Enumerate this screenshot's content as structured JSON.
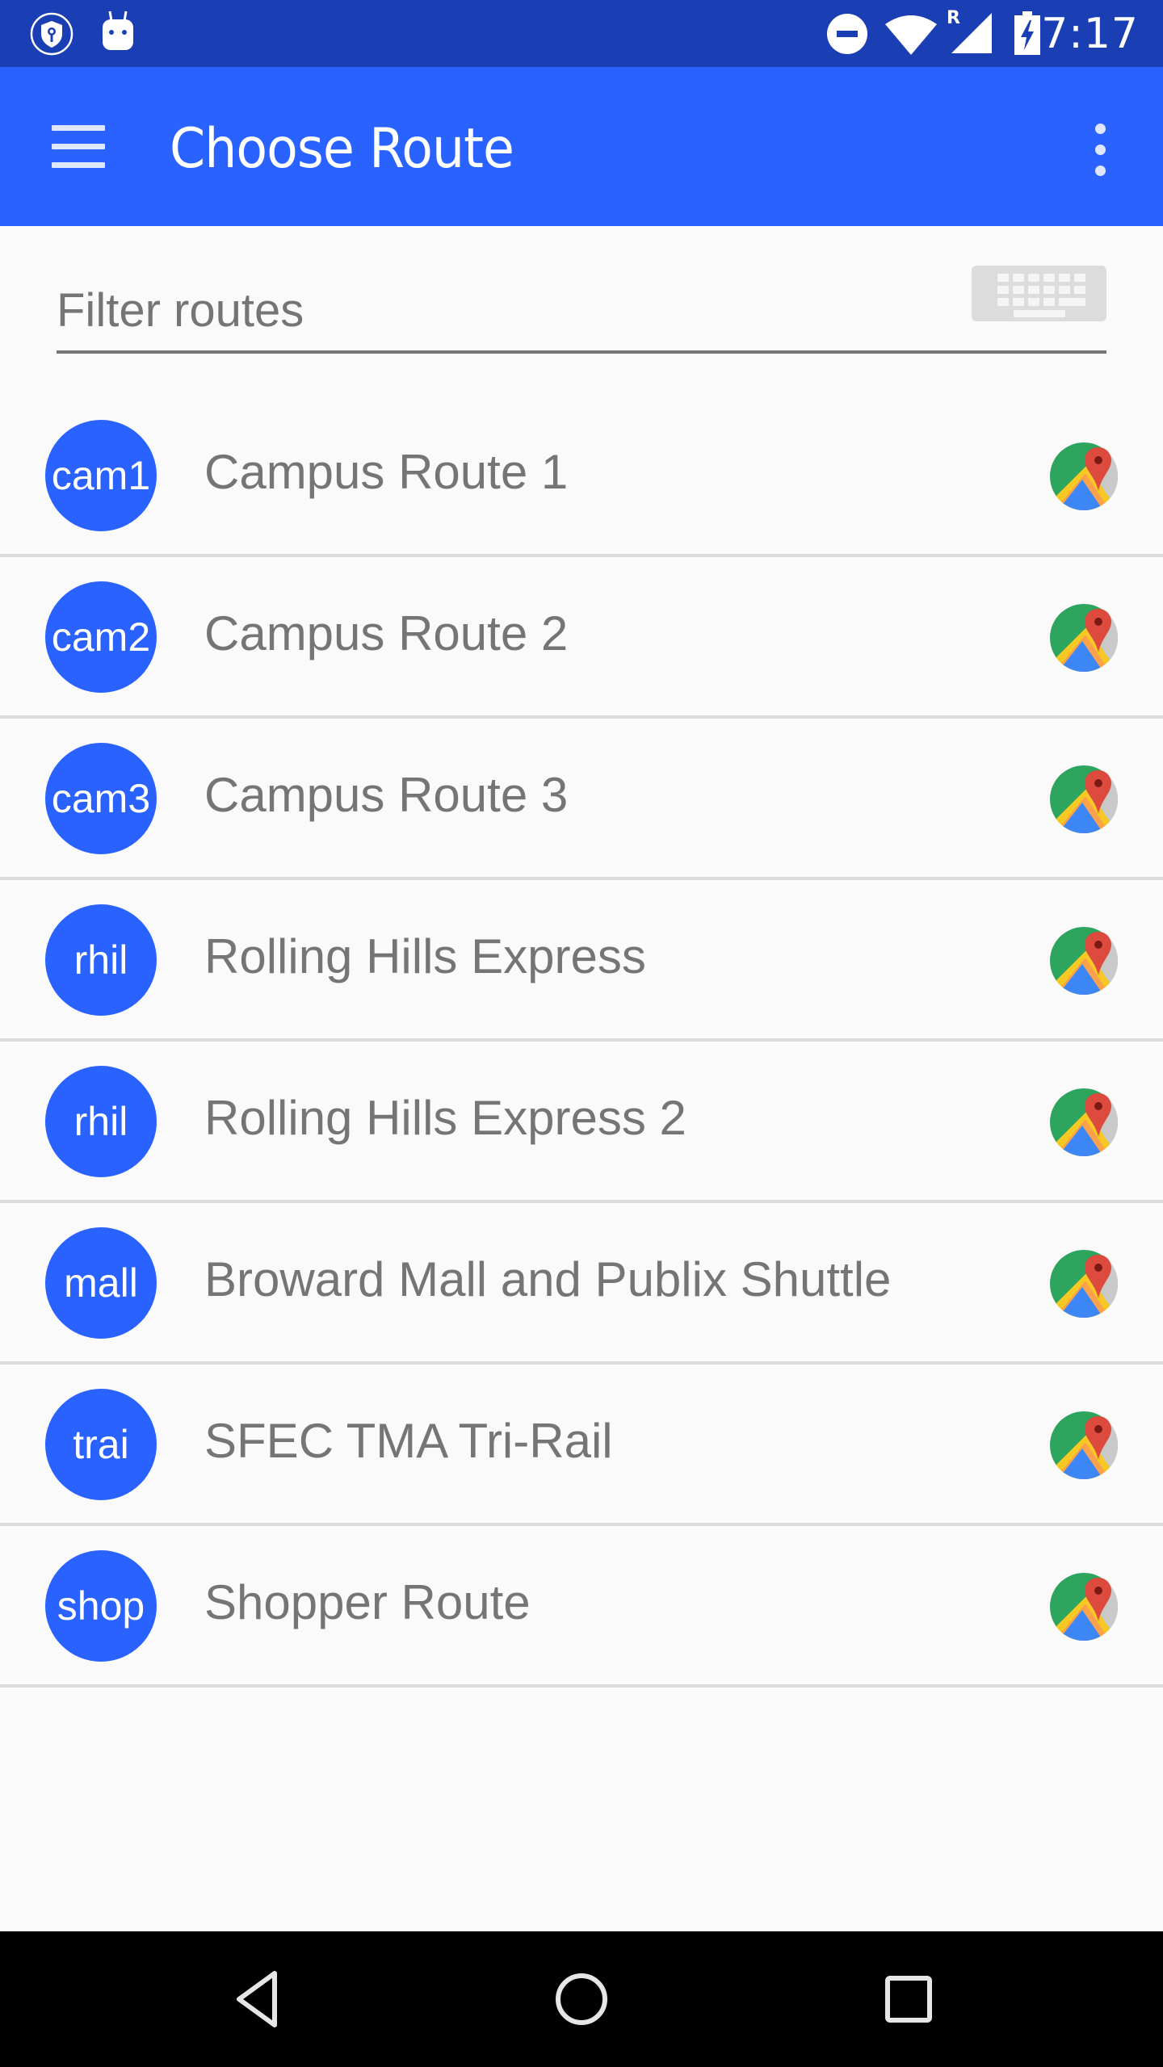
{
  "status_bar": {
    "time": "7:17",
    "left_icons": [
      "vpn-key-shield-icon",
      "android-robot-icon"
    ],
    "right_icons": [
      "do-not-disturb-icon",
      "wifi-icon",
      "roaming-signal-icon",
      "battery-charging-icon"
    ],
    "roaming_label": "R",
    "color": "#1a3fb5"
  },
  "app_bar": {
    "title": "Choose Route",
    "menu_icon": "hamburger-menu-icon",
    "overflow_icon": "more-vert-icon",
    "color": "#2962ff"
  },
  "filter": {
    "placeholder": "Filter routes",
    "value": "",
    "keyboard_icon": "keyboard-icon"
  },
  "routes": [
    {
      "code": "cam1",
      "name": "Campus Route 1"
    },
    {
      "code": "cam2",
      "name": "Campus Route 2"
    },
    {
      "code": "cam3",
      "name": "Campus Route 3"
    },
    {
      "code": "rhil",
      "name": "Rolling Hills Express"
    },
    {
      "code": "rhil",
      "name": "Rolling Hills Express 2"
    },
    {
      "code": "mall",
      "name": "Broward Mall and Publix Shuttle"
    },
    {
      "code": "trai",
      "name": "SFEC TMA Tri-Rail"
    },
    {
      "code": "shop",
      "name": "Shopper Route"
    }
  ],
  "route_action_icon": "google-maps-icon",
  "colors": {
    "accent": "#2962ff",
    "text_secondary": "#757575",
    "divider": "#dcdcdc",
    "background": "#fafafa"
  },
  "nav_bar": {
    "buttons": [
      "back-icon",
      "home-icon",
      "recents-icon"
    ]
  }
}
